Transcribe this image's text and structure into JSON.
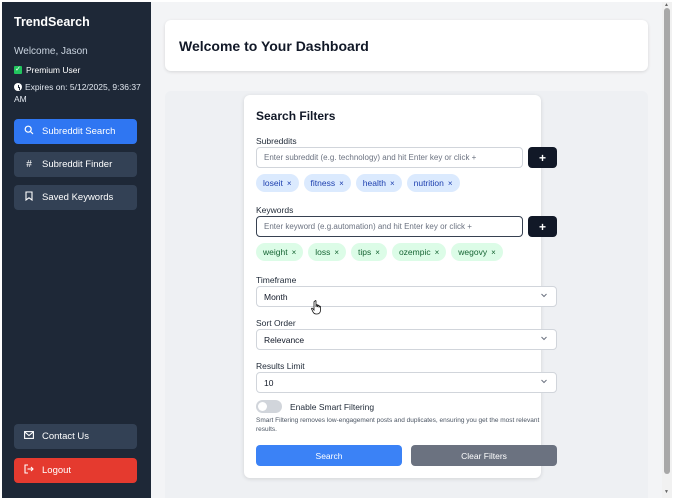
{
  "sidebar": {
    "brand": "TrendSearch",
    "welcome": "Welcome, Jason",
    "premium": "Premium User",
    "expires": "Expires on: 5/12/2025, 9:36:37 AM",
    "nav": [
      {
        "label": "Subreddit Search",
        "icon": "search-icon"
      },
      {
        "label": "Subreddit Finder",
        "icon": "hash-icon"
      },
      {
        "label": "Saved Keywords",
        "icon": "bookmark-icon"
      }
    ],
    "contact": "Contact Us",
    "logout": "Logout"
  },
  "header": {
    "title": "Welcome to Your Dashboard"
  },
  "filters": {
    "title": "Search Filters",
    "subreddits": {
      "label": "Subreddits",
      "placeholder": "Enter subreddit (e.g. technology) and hit Enter key or click +",
      "tags": [
        "loseit",
        "fitness",
        "health",
        "nutrition"
      ]
    },
    "keywords": {
      "label": "Keywords",
      "placeholder": "Enter keyword (e.g.automation) and hit Enter key or click +",
      "tags": [
        "weight",
        "loss",
        "tips",
        "ozempic",
        "wegovy"
      ]
    },
    "add_label": "+",
    "tag_remove": "×",
    "timeframe": {
      "label": "Timeframe",
      "value": "Month"
    },
    "sort": {
      "label": "Sort Order",
      "value": "Relevance"
    },
    "limit": {
      "label": "Results Limit",
      "value": "10"
    },
    "smart": {
      "label": "Enable Smart Filtering",
      "enabled": false,
      "help": "Smart Filtering removes low-engagement posts and duplicates, ensuring you get the most relevant results."
    },
    "search_label": "Search",
    "clear_label": "Clear Filters"
  },
  "colors": {
    "sidebar_bg": "#1e2837",
    "active_nav": "#2f76f2",
    "logout": "#e53a2f",
    "search_btn": "#3b82f6",
    "clear_btn": "#6b7280"
  }
}
